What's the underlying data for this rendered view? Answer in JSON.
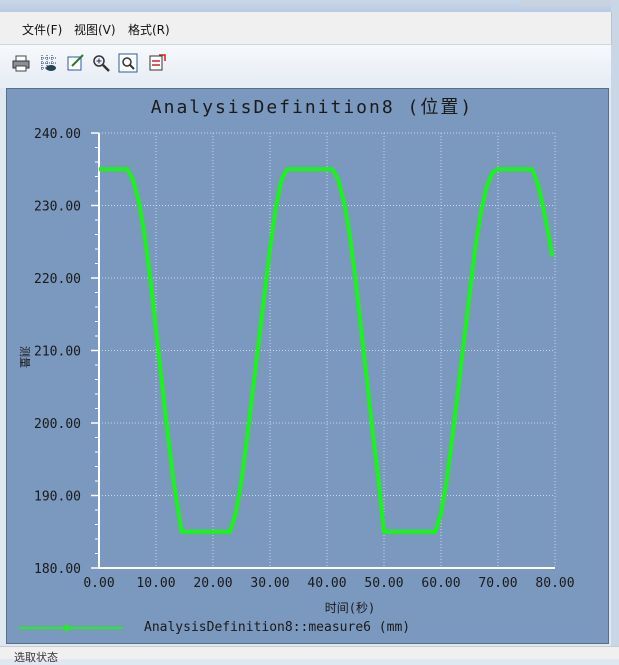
{
  "menu": {
    "file": "文件(F)",
    "view": "视图(V)",
    "format": "格式(R)"
  },
  "toolbar": {
    "icons": [
      "print-icon",
      "grid-icon",
      "edit-icon",
      "zoom-in-icon",
      "zoom-window-icon",
      "export-icon"
    ]
  },
  "status": {
    "text": "选取状态"
  },
  "colors": {
    "plot_bg": "#7b98bf",
    "series": "#19f519",
    "axes": "#ffffff",
    "text": "#1a1a1a"
  },
  "chart_data": {
    "type": "line",
    "title": "AnalysisDefinition8 (位置)",
    "xlabel": "时间(秒)",
    "ylabel": "测量",
    "xlim": [
      0,
      80
    ],
    "ylim": [
      180,
      240
    ],
    "x_ticks": [
      "0.00",
      "10.00",
      "20.00",
      "30.00",
      "40.00",
      "50.00",
      "60.00",
      "70.00",
      "80.00"
    ],
    "y_ticks": [
      "180.00",
      "190.00",
      "200.00",
      "210.00",
      "220.00",
      "230.00",
      "240.00"
    ],
    "grid": true,
    "legend": "bottom",
    "series": [
      {
        "name": "AnalysisDefinition8::measure6 (mm)",
        "x": [
          0,
          5,
          6,
          7,
          8,
          9,
          10,
          11,
          12,
          13,
          14.5,
          23,
          24,
          25,
          26,
          27,
          28,
          29,
          30,
          31,
          32,
          33,
          41,
          42,
          43,
          44,
          45,
          46,
          47,
          48,
          49,
          50,
          51.5,
          59,
          60,
          61,
          62,
          63,
          64,
          65,
          66,
          67,
          68,
          69,
          70,
          76,
          77,
          78,
          79,
          79.5
        ],
        "y": [
          235,
          235,
          233.5,
          230.5,
          226,
          220,
          213,
          206,
          199,
          192.5,
          185,
          185,
          187.5,
          192,
          198,
          204.5,
          211,
          217.5,
          224,
          229.5,
          233.5,
          235,
          235,
          233.5,
          230.5,
          226,
          220,
          213,
          206,
          199,
          192.5,
          185,
          185,
          185,
          187.5,
          192,
          198,
          204.5,
          211,
          217.5,
          224,
          229,
          232.5,
          234.5,
          235,
          235,
          233,
          229.5,
          225.5,
          223
        ]
      }
    ]
  }
}
